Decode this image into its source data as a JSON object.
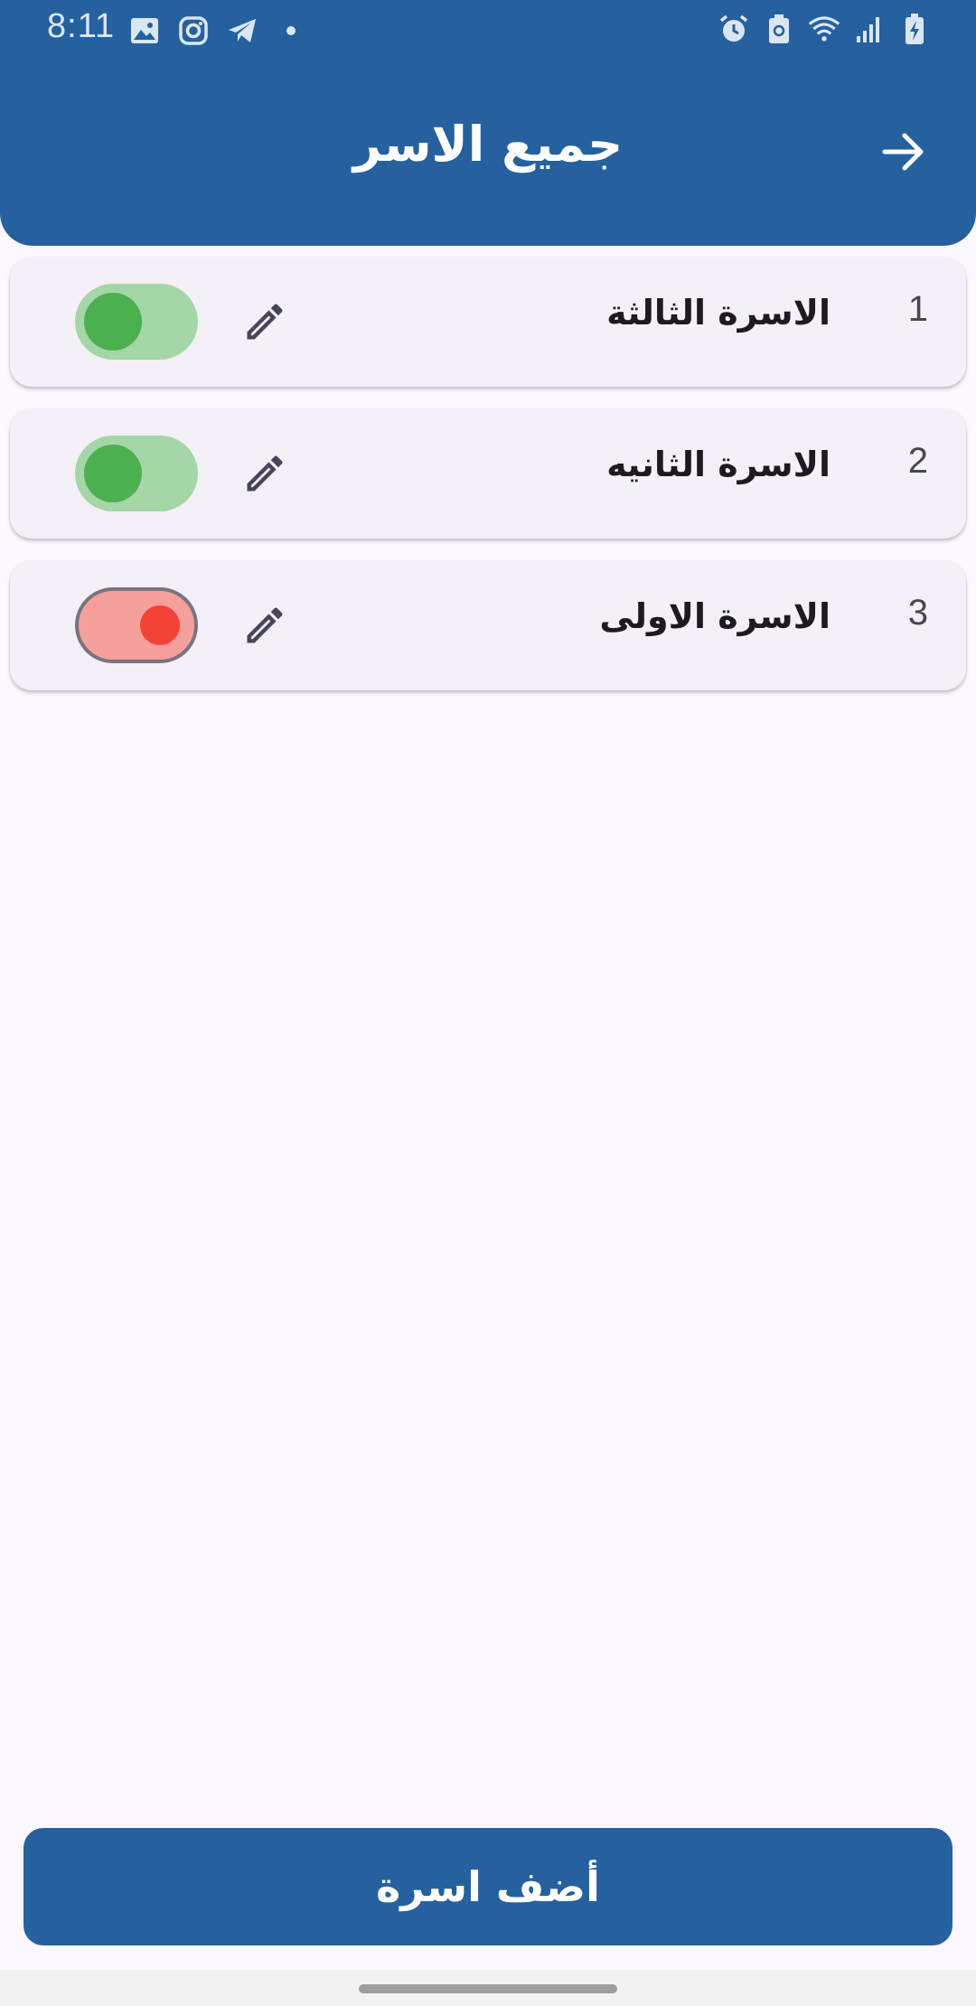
{
  "status_bar": {
    "time": "8:11",
    "left_icons": [
      "gallery-icon",
      "instagram-icon",
      "telegram-icon",
      "dot-icon"
    ],
    "right_icons": [
      "alarm-icon",
      "battery-saver-icon",
      "wifi-icon",
      "signal-icon",
      "battery-charging-icon"
    ]
  },
  "header": {
    "title": "جميع الاسر",
    "back_icon": "arrow-right-icon",
    "background": "#25619f"
  },
  "families": [
    {
      "number": "1",
      "name": "الاسرة الثالثة",
      "active": true
    },
    {
      "number": "2",
      "name": "الاسرة الثانيه",
      "active": true
    },
    {
      "number": "3",
      "name": "الاسرة الاولى",
      "active": false
    }
  ],
  "colors": {
    "switch_on_track": "#a5d6a7",
    "switch_on_knob": "#4caf50",
    "switch_off_track": "#f6a09c",
    "switch_off_knob": "#f44336"
  },
  "footer": {
    "add_label": "أضف اسرة"
  }
}
